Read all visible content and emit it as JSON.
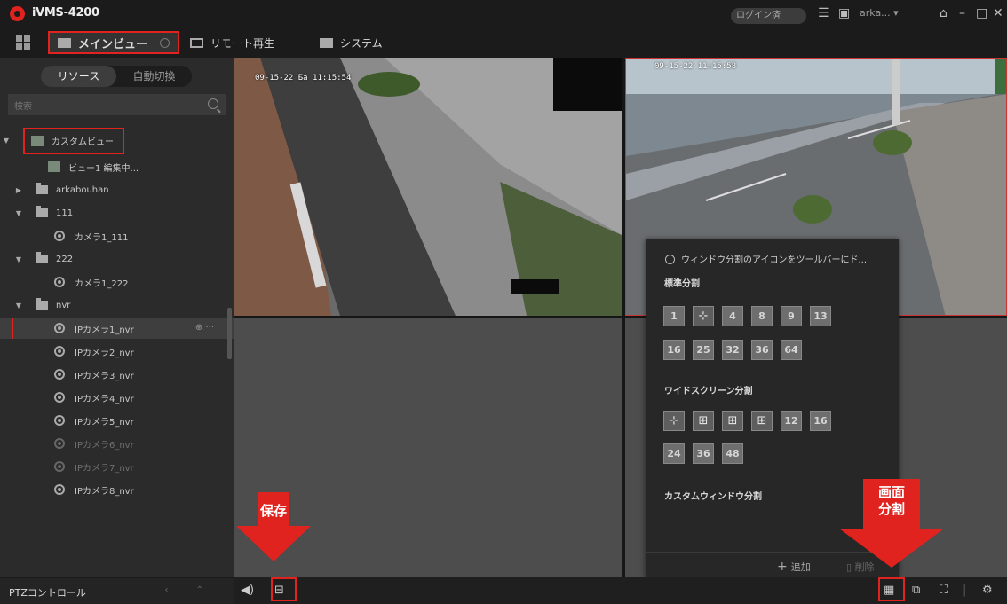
{
  "app": {
    "title": "iVMS-4200"
  },
  "titlebar": {
    "login_status": "ログイン済",
    "user": "arka... ▾",
    "icons": [
      "list-icon",
      "save-icon",
      "lock-icon",
      "minimize-icon",
      "maximize-icon",
      "close-icon"
    ]
  },
  "tabs": {
    "main_view": "メインビュー",
    "remote_playback": "リモート再生",
    "system": "システム"
  },
  "left_panel": {
    "resource_tab": "リソース",
    "auto_switch_tab": "自動切換",
    "search_placeholder": "検索",
    "tree": {
      "custom_view": "カスタムビュー",
      "view1": "ビュー1 編集中...",
      "group_arkabouhan": "arkabouhan",
      "group_111": "111",
      "camera_111": "カメラ1_111",
      "group_222": "222",
      "camera_222": "カメラ1_222",
      "group_nvr": "nvr",
      "ipcam1": "IPカメラ1_nvr",
      "ipcam2": "IPカメラ2_nvr",
      "ipcam3": "IPカメラ3_nvr",
      "ipcam4": "IPカメラ4_nvr",
      "ipcam5": "IPカメラ5_nvr",
      "ipcam6": "IPカメラ6_nvr",
      "ipcam7": "IPカメラ7_nvr",
      "ipcam8": "IPカメラ8_nvr"
    },
    "ptz_label": "PTZコントロール"
  },
  "video": {
    "osd1": "09-15-22 Ба 11:15:54",
    "osd2": "09-15-22 11:15:58"
  },
  "split_popup": {
    "hint": "ウィンドウ分割のアイコンをツールバーにド...",
    "standard_title": "標準分割",
    "standard_row1": [
      "1",
      "⊹",
      "4",
      "8",
      "9",
      "13"
    ],
    "standard_row2": [
      "16",
      "25",
      "32",
      "36",
      "64"
    ],
    "wide_title": "ワイドスクリーン分割",
    "wide_row1": [
      "⊹",
      "⊞",
      "⊞",
      "⊞",
      "12",
      "16"
    ],
    "wide_row2": [
      "24",
      "36",
      "48"
    ],
    "custom_title": "カスタムウィンドウ分割",
    "add": "追加",
    "delete": "削除"
  },
  "annotations": {
    "save": "保存",
    "split_line1": "画面",
    "split_line2": "分割"
  },
  "bottom_bar": {
    "icons": [
      "speaker-icon",
      "save-view-icon",
      "window-split-icon",
      "snapshot-icon",
      "fullscreen-icon",
      "settings-icon"
    ]
  },
  "colors": {
    "accent": "#e0231f",
    "panel": "#2b2b2b",
    "popup": "#272727"
  }
}
